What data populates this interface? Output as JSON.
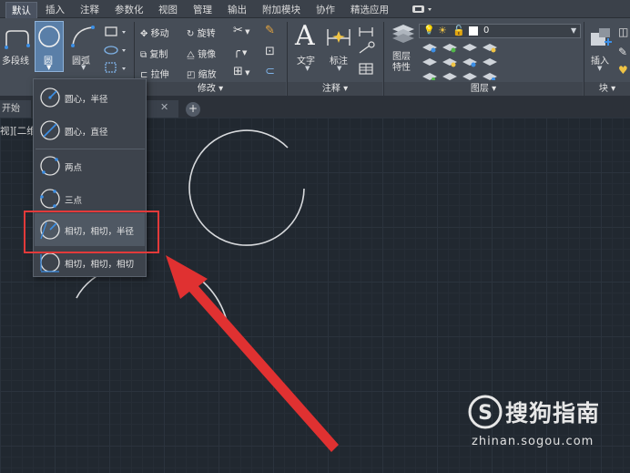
{
  "ribbon_tabs": [
    {
      "label": "默认",
      "active": true
    },
    {
      "label": "插入"
    },
    {
      "label": "注释"
    },
    {
      "label": "参数化"
    },
    {
      "label": "视图"
    },
    {
      "label": "管理"
    },
    {
      "label": "输出"
    },
    {
      "label": "附加模块"
    },
    {
      "label": "协作"
    },
    {
      "label": "精选应用"
    }
  ],
  "draw_panel": {
    "polyline_label": "多段线",
    "circle_label": "圆",
    "arc_label": "圆弧"
  },
  "modify_panel": {
    "title": "修改",
    "move": "移动",
    "rotate": "旋转",
    "copy": "复制",
    "mirror": "镜像",
    "stretch": "拉伸",
    "scale": "缩放"
  },
  "annotation_panel": {
    "title": "注释",
    "text": "文字",
    "dimension": "标注"
  },
  "layers_panel": {
    "title": "图层",
    "layer_props": "图层\n特性",
    "layer_props_line1": "图层",
    "layer_props_line2": "特性",
    "current_layer": "0"
  },
  "block_panel": {
    "title": "块",
    "insert": "插入"
  },
  "doc_tabs": {
    "start_fragment": "开始"
  },
  "viewport_label": "视][二维",
  "circle_menu": [
    {
      "label": "圆心，半径",
      "icon": "circle-center-radius-icon"
    },
    {
      "label": "圆心，直径",
      "icon": "circle-center-diameter-icon"
    },
    {
      "label": "两点",
      "icon": "circle-2point-icon"
    },
    {
      "label": "三点",
      "icon": "circle-3point-icon"
    },
    {
      "label": "相切，相切，半径",
      "icon": "circle-ttr-icon",
      "highlighted": true
    },
    {
      "label": "相切，相切，相切",
      "icon": "circle-ttt-icon"
    }
  ],
  "watermark": {
    "brand": "搜狗指南",
    "url": "zhinan.sogou.com"
  },
  "colors": {
    "accent": "#2f7fd6",
    "annotation_red": "#e23a3a",
    "canvas": "#212830"
  }
}
